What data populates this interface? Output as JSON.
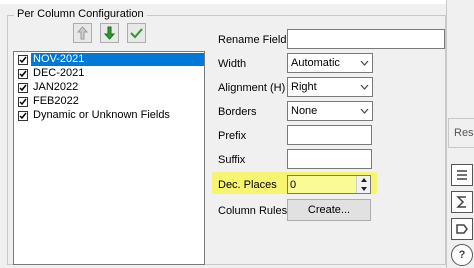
{
  "group": {
    "title": "Per Column Configuration"
  },
  "list": {
    "items": [
      {
        "label": "NOV-2021",
        "checked": true,
        "selected": true
      },
      {
        "label": "DEC-2021",
        "checked": true,
        "selected": false
      },
      {
        "label": "JAN2022",
        "checked": true,
        "selected": false
      },
      {
        "label": "FEB2022",
        "checked": true,
        "selected": false
      },
      {
        "label": "Dynamic or Unknown Fields",
        "checked": true,
        "selected": false
      }
    ]
  },
  "toolbar": {
    "move_up_icon": "arrow-up-icon",
    "move_down_icon": "arrow-down-icon",
    "check_icon": "checkmark-icon"
  },
  "fields": {
    "rename_label": "Rename Field",
    "rename_value": "",
    "width_label": "Width",
    "width_value": "Automatic",
    "alignment_label": "Alignment (H)",
    "alignment_value": "Right",
    "borders_label": "Borders",
    "borders_value": "None",
    "prefix_label": "Prefix",
    "prefix_value": "",
    "suffix_label": "Suffix",
    "suffix_value": "",
    "dec_places_label": "Dec. Places",
    "dec_places_value": "0",
    "column_rules_label": "Column Rules",
    "create_button_label": "Create..."
  },
  "right_panel": {
    "tab_label": "Res"
  },
  "colors": {
    "selection": "#0078d7",
    "highlight": "#f7f45a",
    "down_arrow": "#2e9a2e",
    "check": "#2e9a2e"
  }
}
